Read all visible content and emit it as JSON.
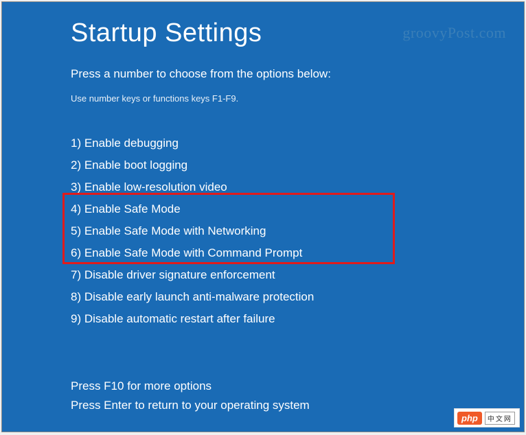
{
  "title": "Startup Settings",
  "instruction": "Press a number to choose from the options below:",
  "hint": "Use number keys or functions keys F1-F9.",
  "options": [
    "1) Enable debugging",
    "2) Enable boot logging",
    "3) Enable low-resolution video",
    "4) Enable Safe Mode",
    "5) Enable Safe Mode with Networking",
    "6) Enable Safe Mode with Command Prompt",
    "7) Disable driver signature enforcement",
    "8) Disable early launch anti-malware protection",
    "9) Disable automatic restart after failure"
  ],
  "footer": {
    "more": "Press F10 for more options",
    "return": "Press Enter to return to your operating system"
  },
  "watermark": "groovyPost.com",
  "logo": {
    "php": "php",
    "cn": "中文网"
  }
}
